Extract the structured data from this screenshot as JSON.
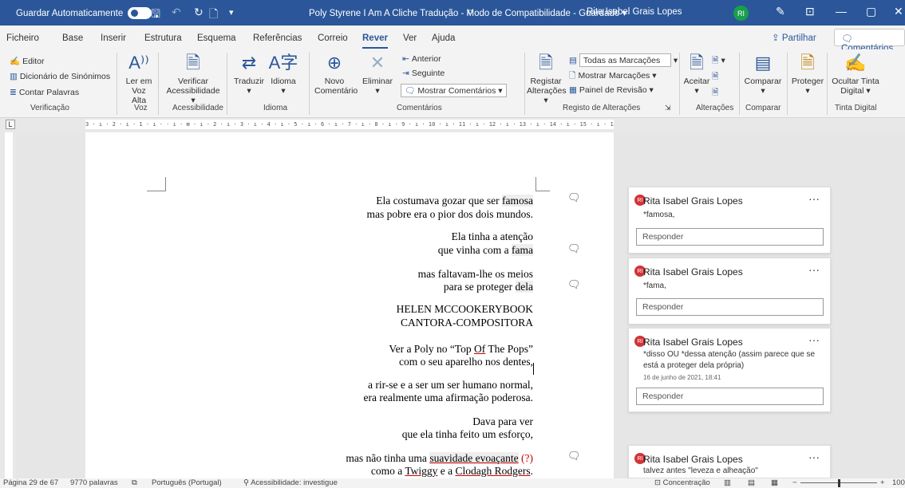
{
  "titlebar": {
    "autosave_label": "Guardar Automaticamente",
    "doc_title": "Poly Styrene I Am A Cliche Tradução - Modo de Compatibilidade - Guardado",
    "user_name": "Rita Isabel Grais Lopes",
    "user_initials": "RI"
  },
  "menu": {
    "tabs": [
      "Ficheiro",
      "Base",
      "Inserir",
      "Estrutura",
      "Esquema",
      "Referências",
      "Correio",
      "Rever",
      "Ver",
      "Ajuda"
    ],
    "share": "Partilhar",
    "comments": "Comentários"
  },
  "ribbon": {
    "editor": "Editor",
    "thesaurus": "Dicionário de Sinónimos",
    "word_count": "Contar Palavras",
    "read_aloud": "Ler em Voz Alta",
    "check_access": "Verificar Acessibilidade",
    "translate": "Traduzir",
    "language": "Idioma",
    "new_comment": "Novo Comentário",
    "delete": "Eliminar",
    "previous": "Anterior",
    "next": "Seguinte",
    "show_comments": "Mostrar Comentários",
    "track_changes": "Registar Alterações",
    "all_markup": "Todas as Marcações",
    "show_markup": "Mostrar Marcações",
    "review_pane": "Painel de Revisão",
    "accept": "Aceitar",
    "compare": "Comparar",
    "protect": "Proteger",
    "hide_ink": "Ocultar Tinta Digital",
    "groups": {
      "proofing": "Verificação",
      "speech": "Voz",
      "accessibility": "Acessibilidade",
      "language": "Idioma",
      "comments": "Comentários",
      "tracking": "Registo de Alterações",
      "changes": "Alterações",
      "compare": "Comparar",
      "ink": "Tinta Digital"
    }
  },
  "ruler": "3 · ı · 2 · ı · 1 · ı ·   · ı · ⊠ · ı · 2 · ı · 3 · ı · 4 · ı · 5 · ı · 6 · ı · 7 · ı · 8 · ı · 9 · ı · 10 · ı · 11 · ı · 12 · ı · 13 · ı · 14 · ı · 15 · ı · 16 · ı · 17 · ı ·",
  "document": {
    "s1a_pre": "Ela costumava gozar que ser ",
    "s1a_word": "famosa",
    "s1b": "mas pobre era o pior dos dois mundos.",
    "s2a": "Ela tinha a atenção",
    "s2b_pre": "que vinha com a ",
    "s2b_word": "fama",
    "s3a": "mas faltavam-lhe os meios",
    "s3b_pre": "para se proteger ",
    "s3b_word": "dela",
    "s4a": "HELEN MCCOOKERYBOOK",
    "s4b": "CANTORA-COMPOSITORA",
    "s5a_pre": "Ver a Poly no “Top ",
    "s5a_of": "Of",
    "s5a_post": " The Pops”",
    "s5b": "com o seu aparelho nos dentes,",
    "s6a": "a rir-se e a ser um ser humano normal,",
    "s6b": "era realmente uma afirmação poderosa.",
    "s7a": "Dava para ver",
    "s7b": "que ela tinha feito um esforço,",
    "s8a_pre": "mas não tinha uma ",
    "s8a_word": "suavidade evoaçante",
    "s8a_mark": "(?)",
    "s8b_pre": "como a ",
    "s8b_twiggy": "Twiggy",
    "s8b_mid": " e a ",
    "s8b_clodagh": "Clodagh Rodgers",
    "s8b_post": "."
  },
  "comments": [
    {
      "author": "Rita Isabel Grais Lopes",
      "text": "*famosa,",
      "reply": "Responder"
    },
    {
      "author": "Rita Isabel Grais Lopes",
      "text": "*fama,",
      "reply": "Responder"
    },
    {
      "author": "Rita Isabel Grais Lopes",
      "text": "*disso OU *dessa atenção (assim parece que se está a proteger dela própria)",
      "date": "16 de junho de 2021, 18:41",
      "reply": "Responder"
    },
    {
      "author": "Rita Isabel Grais Lopes",
      "text": "talvez antes \"leveza e alheação\""
    }
  ],
  "status": {
    "page": "Página 29 de 67",
    "words": "9770 palavras",
    "language": "Português (Portugal)",
    "accessibility": "Acessibilidade: investigue",
    "focus": "Concentração",
    "zoom": "100"
  },
  "colors": {
    "brand": "#2b579a",
    "avatar_comment": "#d13438",
    "avatar_title": "#18a04b"
  }
}
